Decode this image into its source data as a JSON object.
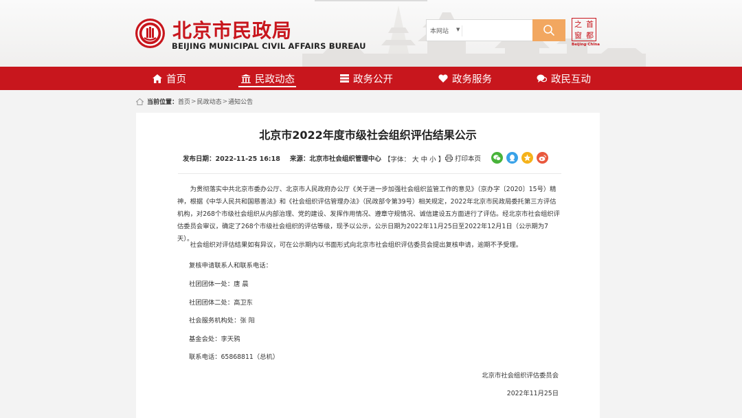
{
  "header": {
    "logo_title": "北京市民政局",
    "logo_subtitle": "BEIJING MUNICIPAL CIVIL AFFAIRS BUREAU",
    "search": {
      "scope": "本网站",
      "placeholder": ""
    },
    "capital_logo": {
      "chars": [
        "之",
        "首",
        "窗",
        "都"
      ],
      "caption": "Beijing·China"
    }
  },
  "nav": {
    "items": [
      {
        "label": "首页",
        "icon": "home-icon"
      },
      {
        "label": "民政动态",
        "icon": "building-icon",
        "active": true
      },
      {
        "label": "政务公开",
        "icon": "document-icon"
      },
      {
        "label": "政务服务",
        "icon": "heart-icon"
      },
      {
        "label": "政民互动",
        "icon": "chat-icon"
      }
    ]
  },
  "breadcrumb": {
    "label": "当前位置：",
    "items": [
      "首页",
      "民政动态",
      "通知公告"
    ],
    "separator": ">"
  },
  "article": {
    "title": "北京市2022年度市级社会组织评估结果公示",
    "date_label": "发布日期：",
    "date": "2022-11-25 16:18",
    "source_label": "来源：",
    "source": "北京市社会组织管理中心",
    "font_size_label": "【字体：",
    "font_sizes": [
      "大",
      "中",
      "小"
    ],
    "font_size_close": "】",
    "print_label": "打印本页",
    "share_icons": [
      "wechat-icon",
      "qq-icon",
      "qzone-icon",
      "weibo-icon"
    ],
    "paragraphs": [
      "为贯彻落实中共北京市委办公厅、北京市人民政府办公厅《关于进一步加强社会组织监管工作的意见》（京办字〔2020〕15号）精神，根据《中华人民共和国慈善法》和《社会组织评估管理办法》（民政部令第39号）相关规定，2022年北京市民政局委托第三方评估机构，对268个市级社会组织从内部治理、党的建设、发挥作用情况、遵章守规情况、诚信建设五方面进行了评估。经北京市社会组织评估委员会审议，确定了268个市级社会组织的评估等级，现予以公示，公示日期为2022年11月25日至2022年12月1日（公示期为7天）。",
      "社会组织对评估结果如有异议，可在公示期内以书面形式向北京市社会组织评估委员会提出复核申请，逾期不予受理。"
    ],
    "contacts_title": "复核申请联系人和联系电话：",
    "contacts": [
      "社团团体一处：唐  晨",
      "社团团体二处：高卫东",
      "社会服务机构处：张  阳",
      "基金会处：李天鸦",
      "联系电话：65868811（总机）"
    ],
    "signature": "北京市社会组织评估委员会",
    "sign_date": "2022年11月25日"
  },
  "colors": {
    "brand_red": "#c8161d",
    "search_orange": "#f2a760"
  }
}
